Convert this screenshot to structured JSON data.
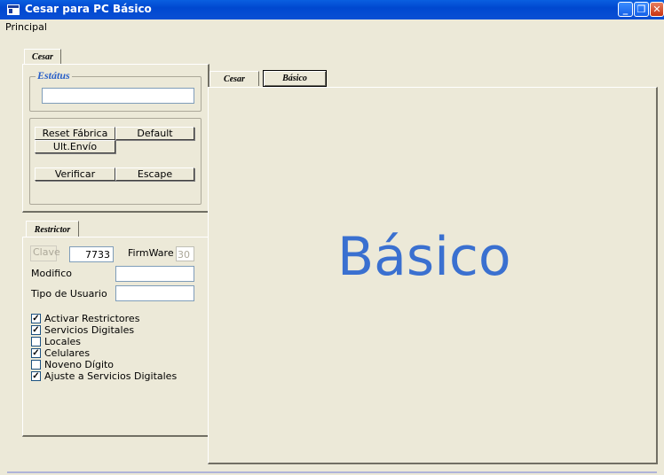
{
  "window": {
    "title": "Cesar para PC Básico",
    "minimize": "_",
    "restore": "❐",
    "close": "✕"
  },
  "menu": {
    "items": [
      "Principal"
    ]
  },
  "left_top_tab": "Cesar",
  "estatus": {
    "legend": "Estátus",
    "value": ""
  },
  "buttons": {
    "reset_fabrica": "Reset Fábrica",
    "default": "Default",
    "ult_envio": "Ult.Envío",
    "verificar": "Verificar",
    "escape": "Escape"
  },
  "restrictor": {
    "tab": "Restrictor",
    "clave_label": "Clave",
    "clave_value": "7733",
    "firmware_label": "FirmWare",
    "firmware_value": "30",
    "modifico_label": "Modifico",
    "modifico_value": "",
    "tipo_usuario_label": "Tipo de Usuario",
    "tipo_usuario_value": "",
    "checkboxes": [
      {
        "label": "Activar Restrictores",
        "checked": true
      },
      {
        "label": "Servicios Digitales",
        "checked": true
      },
      {
        "label": "Locales",
        "checked": false
      },
      {
        "label": "Celulares",
        "checked": true
      },
      {
        "label": "Noveno Dígito",
        "checked": false
      },
      {
        "label": "Ajuste a Servicios Digitales",
        "checked": true
      }
    ]
  },
  "right_tabs": [
    "Cesar",
    "Básico"
  ],
  "right_active_tab": "Básico",
  "content_text": "Básico",
  "colors": {
    "titlebar": "#0a5fe0",
    "window_bg": "#ece9d8",
    "accent_text": "#3a70d0"
  }
}
